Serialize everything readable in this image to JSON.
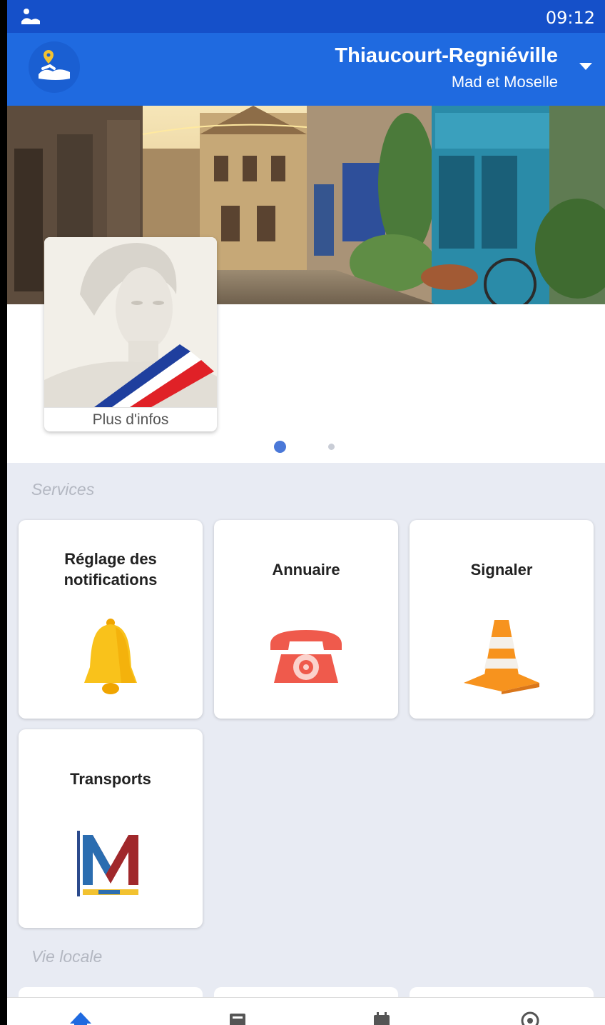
{
  "statusbar": {
    "time": "09:12"
  },
  "header": {
    "town": "Thiaucourt-Regniéville",
    "region": "Mad et Moselle"
  },
  "carousel": {
    "card_caption": "Plus d'infos",
    "pages": 2,
    "active_page": 1
  },
  "sections": {
    "services": "Services",
    "vie_locale": "Vie locale"
  },
  "services": [
    {
      "label": "Réglage des notifications",
      "icon": "bell-icon"
    },
    {
      "label": "Annuaire",
      "icon": "telephone-icon"
    },
    {
      "label": "Signaler",
      "icon": "traffic-cone-icon"
    },
    {
      "label": "Transports",
      "icon": "mad-moselle-logo"
    }
  ],
  "bottom_nav": [
    "home-icon",
    "news-icon",
    "calendar-icon",
    "help-icon"
  ],
  "colors": {
    "statusbar": "#1550c9",
    "appbar": "#1f6ae0",
    "background": "#e8ebf3",
    "active_dot": "#4a78d8"
  }
}
